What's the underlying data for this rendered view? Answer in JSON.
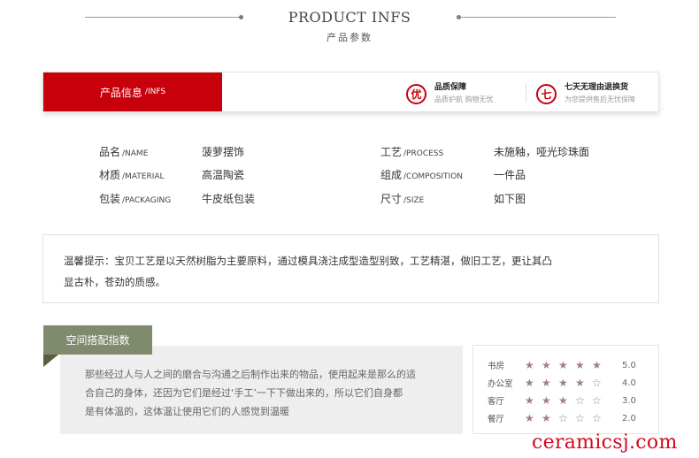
{
  "header": {
    "title": "PRODUCT INFS",
    "subtitle": "产品参数"
  },
  "info_bar": {
    "tab_cn": "产品信息",
    "tab_en": "/INFS",
    "badge1": {
      "icon_char": "优",
      "title": "品质保障",
      "desc": "品质护航 购物无忧"
    },
    "badge2": {
      "icon_char": "七",
      "title": "七天无理由退换货",
      "desc": "为您提供售后无忧保障"
    }
  },
  "params": {
    "name": {
      "label_cn": "品名",
      "label_en": "/NAME",
      "value": "菠萝摆饰"
    },
    "material": {
      "label_cn": "材质",
      "label_en": "/MATERIAL",
      "value": "高温陶瓷"
    },
    "packaging": {
      "label_cn": "包装",
      "label_en": "/PACKAGING",
      "value": "牛皮纸包装"
    },
    "process": {
      "label_cn": "工艺",
      "label_en": "/PROCESS",
      "value": "未施釉，哑光珍珠面"
    },
    "composition": {
      "label_cn": "组成",
      "label_en": "/COMPOSITION",
      "value": "一件品"
    },
    "size": {
      "label_cn": "尺寸",
      "label_en": "/SIZE",
      "value": "如下图"
    }
  },
  "tip": {
    "line1": "温馨提示：宝贝工艺是以天然树脂为主要原料，通过模具浇注成型造型别致，工艺精湛，做旧工艺，更让其凸",
    "line2": "显古朴，苍劲的质感。"
  },
  "space": {
    "tag": "空间搭配指数",
    "desc_line1": "那些经过人与人之间的磨合与沟通之后制作出来的物品，使用起来是那么的适",
    "desc_line2": "合自己的身体，还因为它们是经过‘手工’一下下做出来的，所以它们自身都",
    "desc_line3": "是有体温的，这体温让使用它们的人感觉到温暖",
    "ratings": [
      {
        "room": "书房",
        "stars": 5,
        "score": "5.0"
      },
      {
        "room": "办公室",
        "stars": 4,
        "score": "4.0"
      },
      {
        "room": "客厅",
        "stars": 3,
        "score": "3.0"
      },
      {
        "room": "餐厅",
        "stars": 2,
        "score": "2.0"
      }
    ],
    "star_icons": {
      "full": "star-filled-icon",
      "empty": "star-outline-icon"
    }
  },
  "watermark": "ceramicsj.com",
  "colors": {
    "brand_red": "#c8000b",
    "tag_green": "#808a6c",
    "star": "#9e8080"
  }
}
